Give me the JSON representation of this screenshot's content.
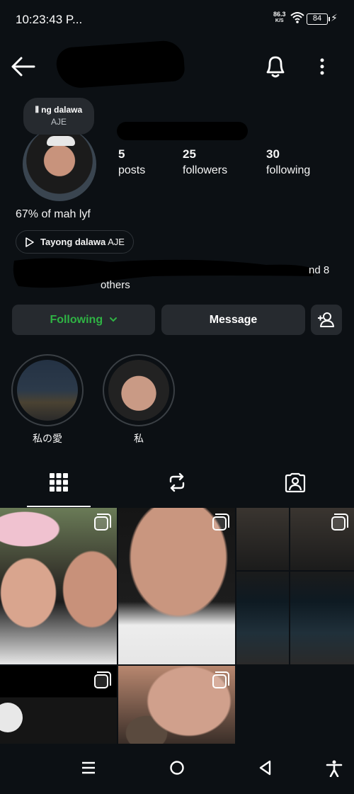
{
  "status": {
    "time": "10:23:43 P...",
    "speed": "86.3",
    "speed_unit": "K/S",
    "battery": "84"
  },
  "profile": {
    "note_line1": "ng dalawa",
    "note_line2": "AJE",
    "stats": [
      {
        "num": "5",
        "label": "posts"
      },
      {
        "num": "25",
        "label": "followers"
      },
      {
        "num": "30",
        "label": "following"
      }
    ],
    "bio": "67% of mah lyf",
    "music_title": "Tayong dalawa",
    "music_artist": "AJE",
    "followed_by_tail": "nd 8",
    "followed_by_tail2": "others"
  },
  "actions": {
    "following": "Following",
    "message": "Message"
  },
  "highlights": [
    {
      "caption": "私の愛"
    },
    {
      "caption": "私"
    }
  ],
  "colors": {
    "background": "#0c1014",
    "button": "#262a2f",
    "following_green": "#2fb344"
  }
}
